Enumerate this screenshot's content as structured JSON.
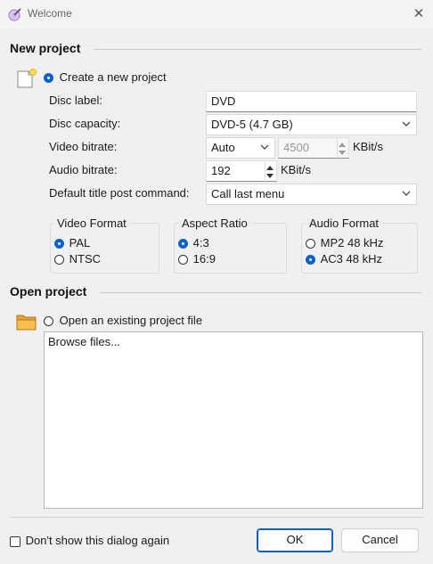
{
  "window": {
    "title": "Welcome"
  },
  "new_project": {
    "section_title": "New project",
    "create_label": "Create a new project",
    "create_selected": true,
    "disc_label": {
      "label": "Disc label:",
      "value": "DVD"
    },
    "disc_capacity": {
      "label": "Disc capacity:",
      "value": "DVD-5 (4.7 GB)"
    },
    "video_bitrate": {
      "label": "Video bitrate:",
      "mode": "Auto",
      "value": "4500",
      "unit": "KBit/s"
    },
    "audio_bitrate": {
      "label": "Audio bitrate:",
      "value": "192",
      "unit": "KBit/s"
    },
    "post_command": {
      "label": "Default title post command:",
      "value": "Call last menu"
    },
    "video_format": {
      "title": "Video Format",
      "options": [
        "PAL",
        "NTSC"
      ],
      "selected": "PAL"
    },
    "aspect_ratio": {
      "title": "Aspect Ratio",
      "options": [
        "4:3",
        "16:9"
      ],
      "selected": "4:3"
    },
    "audio_format": {
      "title": "Audio Format",
      "options": [
        "MP2 48 kHz",
        "AC3 48 kHz"
      ],
      "selected": "AC3 48 kHz"
    }
  },
  "open_project": {
    "section_title": "Open project",
    "open_label": "Open an existing project file",
    "list_items": [
      "Browse files..."
    ]
  },
  "footer": {
    "dont_show_label": "Don't show this dialog again",
    "ok_label": "OK",
    "cancel_label": "Cancel"
  },
  "icons": {
    "app": "dvd-wand-icon",
    "new_project": "new-document-icon",
    "open_project": "folder-icon"
  }
}
